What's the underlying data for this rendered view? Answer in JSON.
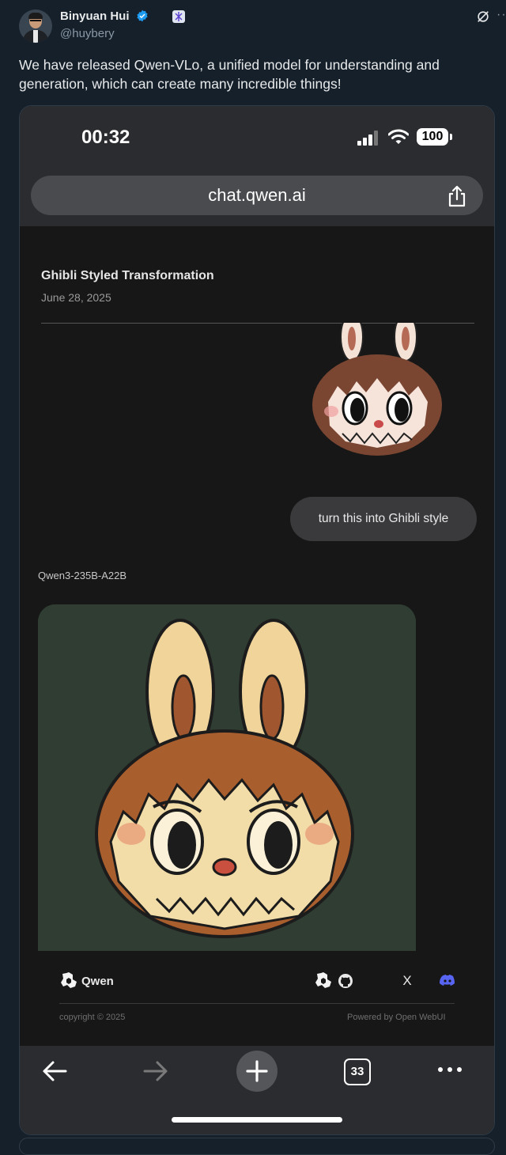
{
  "tweet": {
    "author_name": "Binyuan Hui",
    "handle": "@huybery",
    "text": "We have released Qwen-VLo, a unified model for understanding and generation, which can create many incredible things!",
    "more_label": "···"
  },
  "phone": {
    "time": "00:32",
    "battery": "100",
    "url": "chat.qwen.ai"
  },
  "chat": {
    "title": "Ghibli Styled Transformation",
    "date": "June 28, 2025",
    "user_message": "turn this into Ghibli style",
    "model_name": "Qwen3-235B-A22B"
  },
  "footer": {
    "brand": "Qwen",
    "x_label": "X",
    "copyright": "copyright © 2025",
    "powered_by": "Powered by Open WebUI"
  },
  "toolbar": {
    "tab_count": "33"
  },
  "colors": {
    "page_bg": "#15202b",
    "verified": "#1d9bf0",
    "discord": "#5865f2",
    "phone_chrome": "#2b2c2f",
    "chat_bg": "#171717"
  }
}
